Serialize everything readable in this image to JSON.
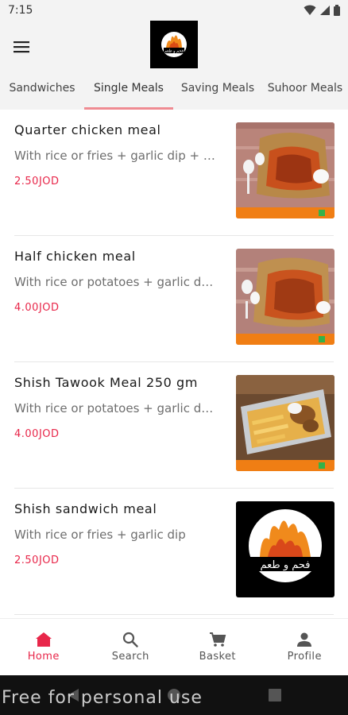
{
  "status_bar": {
    "time": "7:15"
  },
  "app": {
    "logo_text": "فحم و طعم"
  },
  "tabs": [
    {
      "label": "Sandwiches"
    },
    {
      "label": "Single Meals"
    },
    {
      "label": "Saving Meals"
    },
    {
      "label": "Suhoor Meals"
    }
  ],
  "items": [
    {
      "name": "Quarter chicken meal",
      "description": "With rice or fries + garlic dip + …",
      "price": "2.50JOD"
    },
    {
      "name": "Half chicken meal",
      "description": "With rice or potatoes + garlic d…",
      "price": "4.00JOD"
    },
    {
      "name": "Shish Tawook Meal 250 gm",
      "description": "With rice or potatoes + garlic d…",
      "price": "4.00JOD"
    },
    {
      "name": "Shish sandwich meal",
      "description": "With rice or fries + garlic dip",
      "price": "2.50JOD"
    }
  ],
  "bottom_nav": [
    {
      "label": "Home",
      "icon": "home-icon"
    },
    {
      "label": "Search",
      "icon": "search-icon"
    },
    {
      "label": "Basket",
      "icon": "cart-icon"
    },
    {
      "label": "Profile",
      "icon": "person-icon"
    }
  ],
  "watermark": "Free for personal use",
  "colors": {
    "accent": "#e8274a",
    "tab_indicator": "#ef8b92"
  }
}
